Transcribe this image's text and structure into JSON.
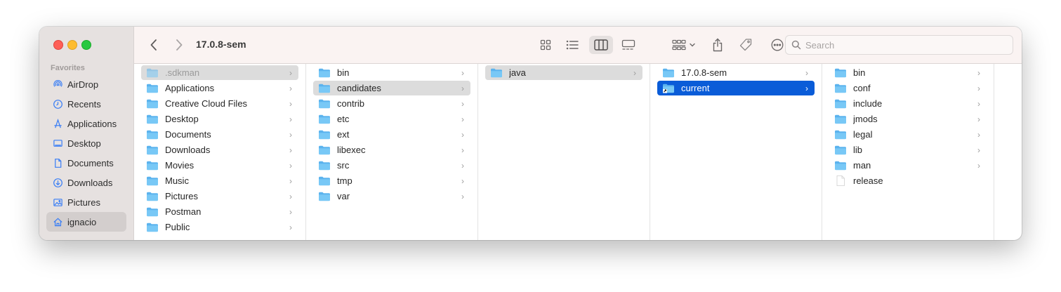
{
  "window": {
    "title": "17.0.8-sem"
  },
  "sidebar": {
    "section_title": "Favorites",
    "items": [
      {
        "label": "AirDrop",
        "icon": "airdrop-icon"
      },
      {
        "label": "Recents",
        "icon": "clock-icon"
      },
      {
        "label": "Applications",
        "icon": "applications-icon"
      },
      {
        "label": "Desktop",
        "icon": "desktop-icon"
      },
      {
        "label": "Documents",
        "icon": "document-icon"
      },
      {
        "label": "Downloads",
        "icon": "download-icon"
      },
      {
        "label": "Pictures",
        "icon": "pictures-icon"
      },
      {
        "label": "ignacio",
        "icon": "home-icon",
        "selected": true
      }
    ]
  },
  "toolbar": {
    "back": "chevron-left-icon",
    "forward": "chevron-right-icon",
    "views": [
      "icon-view",
      "list-view",
      "column-view",
      "gallery-view"
    ],
    "active_view": "column-view",
    "search_placeholder": "Search"
  },
  "columns": [
    {
      "items": [
        {
          "label": ".sdkman",
          "folder": true,
          "state": "selected-dim"
        },
        {
          "label": "Applications",
          "folder": true
        },
        {
          "label": "Creative Cloud Files",
          "folder": true
        },
        {
          "label": "Desktop",
          "folder": true
        },
        {
          "label": "Documents",
          "folder": true
        },
        {
          "label": "Downloads",
          "folder": true
        },
        {
          "label": "Movies",
          "folder": true
        },
        {
          "label": "Music",
          "folder": true
        },
        {
          "label": "Pictures",
          "folder": true
        },
        {
          "label": "Postman",
          "folder": true
        },
        {
          "label": "Public",
          "folder": true
        }
      ]
    },
    {
      "items": [
        {
          "label": "bin",
          "folder": true
        },
        {
          "label": "candidates",
          "folder": true,
          "state": "selected-gray"
        },
        {
          "label": "contrib",
          "folder": true
        },
        {
          "label": "etc",
          "folder": true
        },
        {
          "label": "ext",
          "folder": true
        },
        {
          "label": "libexec",
          "folder": true
        },
        {
          "label": "src",
          "folder": true
        },
        {
          "label": "tmp",
          "folder": true
        },
        {
          "label": "var",
          "folder": true
        }
      ]
    },
    {
      "items": [
        {
          "label": "java",
          "folder": true,
          "state": "selected-gray"
        }
      ]
    },
    {
      "items": [
        {
          "label": "17.0.8-sem",
          "folder": true
        },
        {
          "label": "current",
          "folder": true,
          "alias": true,
          "state": "selected-blue"
        }
      ]
    },
    {
      "items": [
        {
          "label": "bin",
          "folder": true
        },
        {
          "label": "conf",
          "folder": true
        },
        {
          "label": "include",
          "folder": true
        },
        {
          "label": "jmods",
          "folder": true
        },
        {
          "label": "legal",
          "folder": true
        },
        {
          "label": "lib",
          "folder": true
        },
        {
          "label": "man",
          "folder": true
        },
        {
          "label": "release",
          "folder": false
        }
      ]
    }
  ],
  "colors": {
    "selection_blue": "#0a5cd8",
    "folder_blue": "#6cc1f5",
    "sidebar_icon": "#3a7ef5"
  }
}
